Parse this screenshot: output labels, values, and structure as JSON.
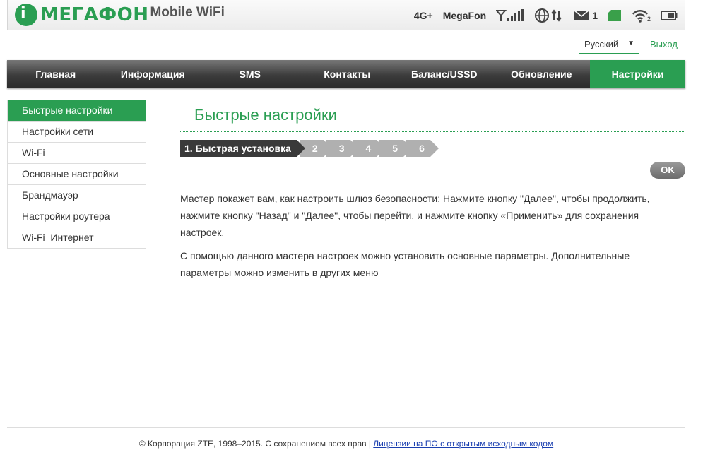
{
  "header": {
    "brand": "МЕГАФОН",
    "product": "Mobile WiFi",
    "network_type": "4G+",
    "operator": "MegaFon",
    "sms_count": "1",
    "wifi_clients": "2"
  },
  "lang": {
    "selected": "Русский",
    "logout": "Выход"
  },
  "nav": {
    "tabs": [
      "Главная",
      "Информация",
      "SMS",
      "Контакты",
      "Баланс/USSD",
      "Обновление",
      "Настройки"
    ],
    "active": "Настройки"
  },
  "sidebar": {
    "items": [
      "Быстрые настройки",
      "Настройки сети",
      "Wi-Fi",
      "Основные настройки",
      "Брандмауэр",
      "Настройки роутера",
      "Wi-Fi  Интернет"
    ]
  },
  "main": {
    "title": "Быстрые настройки",
    "steps": [
      "1. Быстрая установка",
      "2",
      "3",
      "4",
      "5",
      "6"
    ],
    "ok_label": "OK",
    "para1": "Мастер покажет вам, как настроить шлюз безопасности: Нажмите кнопку \"Далее\", чтобы продолжить, нажмите кнопку \"Назад\" и \"Далее\", чтобы перейти, и нажмите кнопку «Применить» для сохранения настроек.",
    "para2": "С помощью данного мастера настроек можно установить основные параметры. Дополнительные параметры можно изменить в других меню"
  },
  "footer": {
    "copyright": "© Корпорация ZTE, 1998–2015. С сохранением всех прав  |",
    "license_link": "Лицензии на ПО с открытым исходным кодом"
  },
  "colors": {
    "accent": "#2a9e52",
    "nav_dark": "#3b3b3b"
  }
}
